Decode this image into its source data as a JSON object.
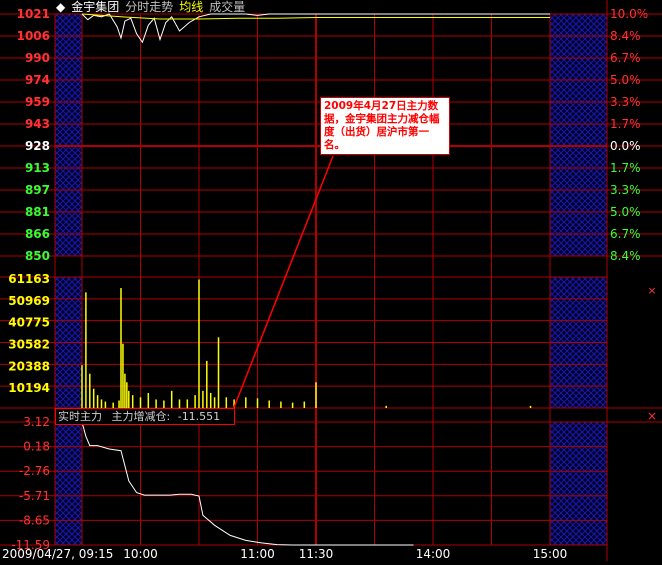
{
  "header": {
    "stock_name": "金宇集团",
    "view_label": "分时走势",
    "avg_label": "均线",
    "volume_label": "成交量"
  },
  "annotation": {
    "text": "2009年4月27日主力数据，金宇集团主力减仓幅度（出货）居沪市第一名。"
  },
  "flow_panel": {
    "indicator_label": "实时主力",
    "metric_label": "主力增减仓:",
    "metric_value": "-11.551"
  },
  "colors": {
    "grid": "#b00000",
    "price_up": "#ff3333",
    "price_down": "#33ff33",
    "price_ref": "#ffffff",
    "price_line": "#ffffff",
    "avg_line": "#ffff00",
    "volume_bar": "#ffff00",
    "closed_region": "#1a1aa0"
  },
  "chart_data": [
    {
      "type": "line",
      "title": "分时走势",
      "ylim": [
        850,
        1021
      ],
      "reference_price": 928,
      "left_tick_labels": [
        "1021",
        "1006",
        "990",
        "974",
        "959",
        "943",
        "928",
        "913",
        "897",
        "881",
        "866",
        "850"
      ],
      "right_tick_labels": [
        "10.0%",
        "8.4%",
        "6.7%",
        "5.0%",
        "3.3%",
        "1.7%",
        "0.0%",
        "1.7%",
        "3.3%",
        "5.0%",
        "6.7%",
        "8.4%"
      ],
      "x_tick_labels": [
        "2009/04/27, 09:15",
        "10:00",
        "11:00",
        "11:30",
        "14:00",
        "15:00"
      ],
      "x_index_range": [
        0,
        240
      ],
      "series": [
        {
          "name": "分时走势",
          "x": [
            0,
            3,
            6,
            10,
            14,
            18,
            20,
            22,
            25,
            28,
            31,
            34,
            37,
            40,
            43,
            46,
            50,
            55,
            60,
            66,
            72,
            78,
            84,
            90,
            96,
            102,
            108,
            114,
            120,
            240
          ],
          "y": [
            1021,
            1017,
            1020,
            1019,
            1021,
            1012,
            1004,
            1016,
            1018,
            1007,
            1001,
            1013,
            1018,
            1003,
            1015,
            1019,
            1009,
            1015,
            1019,
            1021,
            1021,
            1021,
            1021,
            1020,
            1021,
            1021,
            1021,
            1021,
            1021,
            1021
          ]
        },
        {
          "name": "均线",
          "x": [
            0,
            20,
            40,
            60,
            80,
            100,
            120,
            240
          ],
          "y": [
            1021,
            1019,
            1017.5,
            1017.5,
            1018,
            1018,
            1018.5,
            1018.5
          ]
        }
      ]
    },
    {
      "type": "bar",
      "title": "成交量",
      "ylim": [
        0,
        61163
      ],
      "tick_labels": [
        "61163",
        "50969",
        "40775",
        "30582",
        "20388",
        "10194"
      ],
      "x": [
        0,
        2,
        4,
        6,
        8,
        10,
        12,
        16,
        19,
        20,
        21,
        22,
        23,
        24,
        26,
        30,
        34,
        38,
        42,
        46,
        50,
        54,
        58,
        60,
        62,
        64,
        66,
        68,
        70,
        74,
        78,
        84,
        90,
        96,
        102,
        108,
        114,
        120,
        156,
        230
      ],
      "values": [
        20000,
        54000,
        16000,
        9000,
        6000,
        4000,
        3000,
        2500,
        3500,
        56000,
        30000,
        16000,
        12000,
        8000,
        6000,
        5000,
        7000,
        4000,
        3500,
        8000,
        4000,
        4000,
        6000,
        60000,
        8000,
        22000,
        7000,
        5000,
        33000,
        5000,
        4000,
        5000,
        4500,
        3500,
        3000,
        2500,
        3000,
        12000,
        1000,
        1000
      ]
    },
    {
      "type": "line",
      "title": "实时主力",
      "ylim": [
        -11.55,
        3.12
      ],
      "tick_labels": [
        "3.12",
        "0.18",
        "-2.76",
        "-5.71",
        "-8.65",
        "-11.59"
      ],
      "series": [
        {
          "name": "实时主力",
          "x": [
            0,
            2,
            4,
            8,
            14,
            20,
            24,
            28,
            32,
            38,
            45,
            50,
            56,
            60,
            62,
            68,
            76,
            84,
            92,
            100,
            108,
            114,
            120,
            160,
            170
          ],
          "y": [
            3.12,
            1.4,
            0.3,
            0.3,
            -0.1,
            -0.3,
            -3.9,
            -5.3,
            -5.6,
            -5.6,
            -5.6,
            -5.5,
            -5.5,
            -5.7,
            -8.0,
            -9.2,
            -10.4,
            -11.0,
            -11.3,
            -11.5,
            -11.55,
            -11.55,
            -11.55,
            -11.55,
            -11.55
          ]
        }
      ]
    }
  ]
}
